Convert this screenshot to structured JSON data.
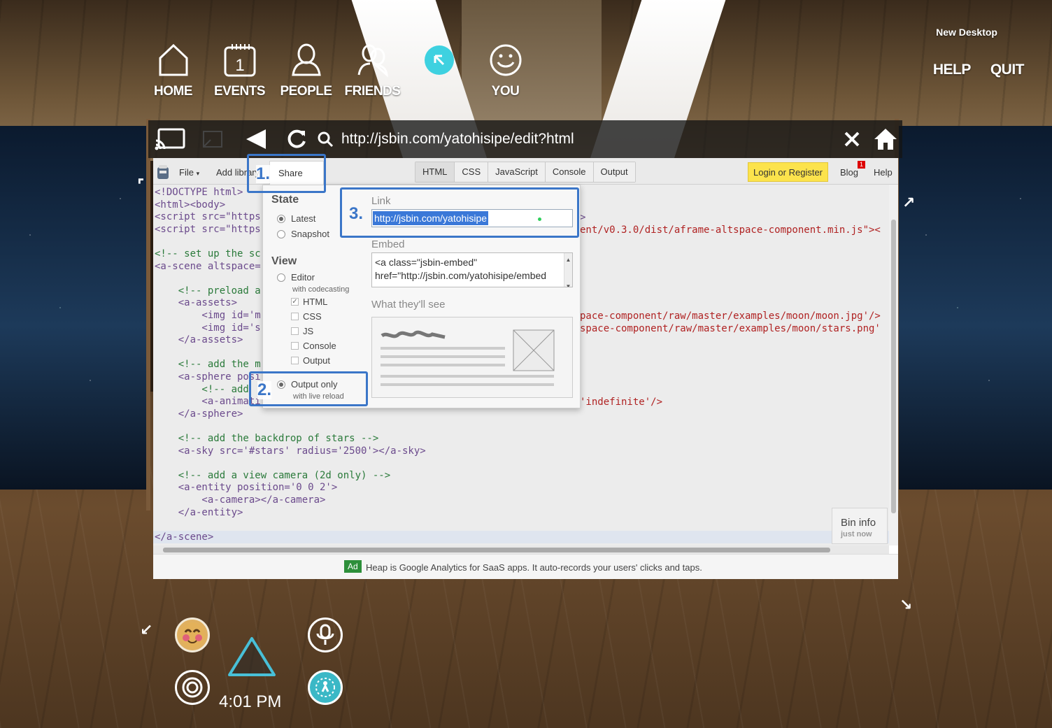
{
  "top_nav": {
    "items": [
      {
        "label": "HOME",
        "icon": "home-icon"
      },
      {
        "label": "EVENTS",
        "icon": "calendar-icon",
        "badge": "1"
      },
      {
        "label": "PEOPLE",
        "icon": "person-icon"
      },
      {
        "label": "FRIENDS",
        "icon": "friends-icon"
      },
      {
        "label": "",
        "icon": "cursor-mode-icon"
      },
      {
        "label": "YOU",
        "icon": "smile-icon"
      }
    ],
    "new_desktop": "New Desktop",
    "help": "HELP",
    "quit": "QUIT"
  },
  "browser": {
    "url": "http://jsbin.com/yatohisipe/edit?html",
    "accent": "#3ed1e0"
  },
  "jsbin": {
    "file": "File",
    "add_library": "Add library",
    "share": "Share",
    "panels": [
      "HTML",
      "CSS",
      "JavaScript",
      "Console",
      "Output"
    ],
    "login": "Login or Register",
    "blog": "Blog",
    "blog_badge": "1",
    "help": "Help",
    "bin_info_title": "Bin info",
    "bin_info_time": "just now",
    "ad_badge": "Ad",
    "ad_text": "Heap is Google Analytics for SaaS apps. It auto-records your users' clicks and taps."
  },
  "code_lines": [
    "<!DOCTYPE html>",
    "<html><body>",
    "<script src=\"https",
    "<script src=\"https",
    "",
    "<!-- set up the sc",
    "<a-scene altspace=",
    "",
    "    <!-- preload a",
    "    <a-assets>",
    "        <img id='m",
    "        <img id='s",
    "    </a-assets>",
    "",
    "    <!-- add the m",
    "    <a-sphere posi",
    "        <!-- add",
    "        <a-animati",
    "    </a-sphere>",
    "",
    "    <!-- add the backdrop of stars -->",
    "    <a-sky src='#stars' radius='2500'></a-sky>",
    "",
    "    <!-- add a view camera (2d only) -->",
    "    <a-entity position='0 0 2'>",
    "        <a-camera></a-camera>",
    "    </a-entity>",
    "",
    "</a-scene>"
  ],
  "code_right_fragments": {
    "line3": ">",
    "line4": "ent/v0.3.0/dist/aframe-altspace-component.min.js\"><",
    "line10": "pace-component/raw/master/examples/moon/moon.jpg'/>",
    "line11": "space-component/raw/master/examples/moon/stars.png'",
    "line17": "'indefinite'/>"
  },
  "share_panel": {
    "state_heading": "State",
    "latest": "Latest",
    "snapshot": "Snapshot",
    "view_heading": "View",
    "editor": "Editor",
    "editor_sub": "with codecasting",
    "checks": [
      {
        "label": "HTML",
        "checked": true
      },
      {
        "label": "CSS",
        "checked": false
      },
      {
        "label": "JS",
        "checked": false
      },
      {
        "label": "Console",
        "checked": false
      },
      {
        "label": "Output",
        "checked": false
      }
    ],
    "output_only": "Output only",
    "output_only_sub": "with live reload",
    "link_label": "Link",
    "link_value": "http://jsbin.com/yatohisipe",
    "embed_label": "Embed",
    "embed_line1": "<a class=\"jsbin-embed\"",
    "embed_line2": "href=\"http://jsbin.com/yatohisipe/embed",
    "preview_label": "What they'll see"
  },
  "callouts": {
    "one": "1.",
    "two": "2.",
    "three": "3.",
    "color": "#3b76c8"
  },
  "hud": {
    "time": "4:01 PM"
  }
}
